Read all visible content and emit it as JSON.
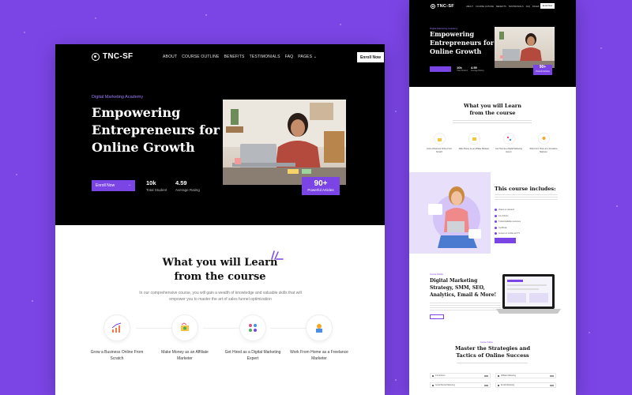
{
  "main": {
    "logo": "TNC-SF",
    "nav": [
      "ABOUT",
      "COURSE OUTLINE",
      "BENEFITS",
      "TESTIMONIALS",
      "FAQ",
      "PAGES ⌄"
    ],
    "enroll_nav": "Enroll Now",
    "eyebrow": "Digital Marketing Academy",
    "title": "Empowering Entrepreneurs for Online Growth",
    "cta": "Enroll Now",
    "stats": [
      {
        "value": "10k",
        "label": "Total Student"
      },
      {
        "value": "4.59",
        "label": "Average Rating"
      }
    ],
    "badge": {
      "value": "90+",
      "label": "Powerful Articles"
    },
    "learn": {
      "line1": "What you will Learn",
      "line2": "from the course",
      "subtitle": "In our comprehensive course, you will gain a wealth of knowledge and valuable skills that will empower you to master the art of sales funnel optimization"
    },
    "features": [
      {
        "label": "Grow a Business Online From Scratch",
        "icon": "growth-chart-icon"
      },
      {
        "label": "Make Money as an Affiliate Marketer",
        "icon": "money-icon"
      },
      {
        "label": "Get Hired as a Digital Marketing Expert",
        "icon": "network-icon"
      },
      {
        "label": "Work From Home as a Freelance Marketer",
        "icon": "home-work-icon"
      }
    ]
  },
  "right": {
    "logo": "TNC-SF",
    "nav": [
      "ABOUT",
      "COURSE OUTLINE",
      "BENEFITS",
      "TESTIMONIALS",
      "FAQ",
      "PAGES"
    ],
    "enroll_nav": "Enroll Now",
    "eyebrow": "Digital Marketing Academy",
    "title": "Empowering Entrepreneurs for Online Growth",
    "stats": [
      {
        "value": "10k",
        "label": "Total Student"
      },
      {
        "value": "4.59",
        "label": "Average Rating"
      }
    ],
    "badge": {
      "value": "90+",
      "label": "Powerful Articles"
    },
    "learn": {
      "line1": "What you will Learn",
      "line2": "from the course"
    },
    "features": [
      "Grow a Business Online From Scratch",
      "Make Money as an Affiliate Marketer",
      "Get Hired as a Digital Marketing Expert",
      "Work From Home as a Freelance Marketer"
    ],
    "course_title": "This course includes:",
    "course_items": [
      "Videos on demand",
      "12+ Articles",
      "5 downloadable resources",
      "Certificate",
      "Access on mobile and TV",
      "Lifetime access"
    ],
    "dm_eyebrow": "Course Details",
    "dm_title": "Digital Marketing Strategy, SMM, SEO, Analytics, Email & More!",
    "master_eyebrow": "Course Outline",
    "master_line1": "Master the Strategies and",
    "master_line2": "Tactics of Online Success",
    "rows": [
      [
        "Introduction",
        "Affiliate Marketing"
      ],
      [
        "Social Media Marketing",
        "Email Marketing"
      ]
    ]
  },
  "colors": {
    "accent": "#7b45e6",
    "hero_bg": "#000000",
    "eyebrow": "#9f7bff"
  }
}
